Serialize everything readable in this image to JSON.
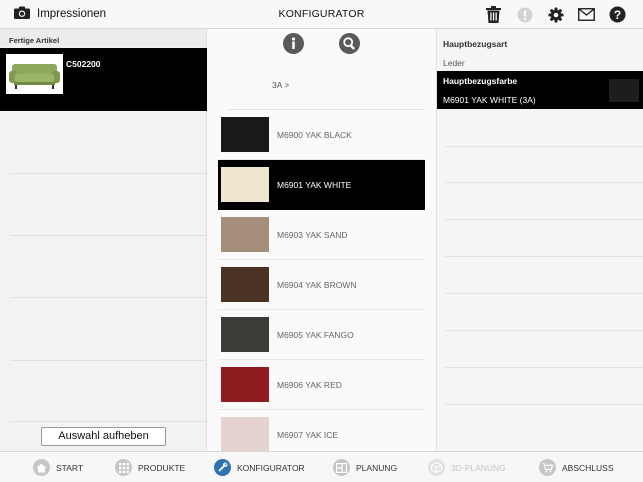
{
  "topbar": {
    "impressions_label": "Impressionen",
    "title": "KONFIGURATOR"
  },
  "left": {
    "section_header": "Fertige Artikel",
    "selected_item_code": "C502200",
    "selection_button": "Auswahl aufheben"
  },
  "middle": {
    "breadcrumb": "3A >",
    "colors": [
      {
        "label": "M6900 YAK BLACK",
        "swatch": "#191919",
        "selected": false
      },
      {
        "label": "M6901 YAK WHITE",
        "swatch": "#efe6cf",
        "selected": true
      },
      {
        "label": "M6903 YAK SAND",
        "swatch": "#a58f7a",
        "selected": false
      },
      {
        "label": "M6904 YAK BROWN",
        "swatch": "#4a3325",
        "selected": false
      },
      {
        "label": "M6905 YAK FANGO",
        "swatch": "#3b3b38",
        "selected": false
      },
      {
        "label": "M6906 YAK RED",
        "swatch": "#8e1c20",
        "selected": false
      },
      {
        "label": "M6907 YAK ICE",
        "swatch": "#e4d3cf",
        "selected": false
      }
    ]
  },
  "right": {
    "main_cover_type_label": "Hauptbezugsart",
    "main_cover_type_value": "Leder",
    "main_cover_color_label": "Hauptbezugsfarbe",
    "main_cover_color_value": "M6901 YAK WHITE (3A)"
  },
  "tabs": [
    {
      "label": "START",
      "state": "normal"
    },
    {
      "label": "PRODUKTE",
      "state": "normal"
    },
    {
      "label": "KONFIGURATOR",
      "state": "active"
    },
    {
      "label": "PLANUNG",
      "state": "normal"
    },
    {
      "label": "3D-PLANUNG",
      "state": "disabled"
    },
    {
      "label": "ABSCHLUSS",
      "state": "normal"
    }
  ]
}
